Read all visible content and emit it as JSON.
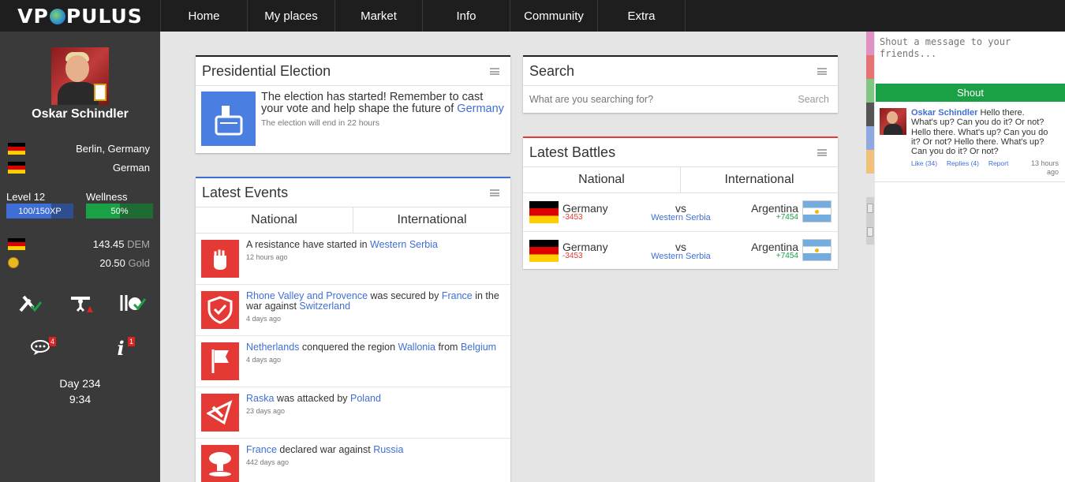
{
  "logo": {
    "left": "VP",
    "right": "PULUS"
  },
  "nav": [
    {
      "label": "Home"
    },
    {
      "label": "My places"
    },
    {
      "label": "Market"
    },
    {
      "label": "Info"
    },
    {
      "label": "Community"
    },
    {
      "label": "Extra"
    }
  ],
  "profile": {
    "name": "Oskar Schindler",
    "location": "Berlin, Germany",
    "citizenship": "German",
    "level_label": "Level 12",
    "xp_text": "100/150XP",
    "xp_fraction": 0.667,
    "wellness_label": "Wellness",
    "wellness_text": "50%",
    "wellness_fraction": 0.5,
    "currency_value": "143.45",
    "currency_code": "DEM",
    "gold_value": "20.50",
    "gold_label": "Gold",
    "messages_count": "4",
    "alerts_count": "1",
    "day": "Day 234",
    "time": "9:34"
  },
  "election": {
    "title": "Presidential Election",
    "text": "The election has started! Remember to cast your vote and help shape the future of",
    "country": "Germany",
    "subtext": "The election will end in 22 hours"
  },
  "events": {
    "title": "Latest Events",
    "tabs": [
      "National",
      "International"
    ],
    "items": [
      {
        "icon": "fist-icon",
        "parts": [
          {
            "t": "A resistance have started in ",
            "l": false
          },
          {
            "t": "Western Serbia",
            "l": true
          }
        ],
        "time": "12 hours ago"
      },
      {
        "icon": "shield-icon",
        "parts": [
          {
            "t": "Rhone Valley and Provence",
            "l": true
          },
          {
            "t": " was secured by ",
            "l": false
          },
          {
            "t": "France",
            "l": true
          },
          {
            "t": " in the war against ",
            "l": false
          },
          {
            "t": "Switzerland",
            "l": true
          }
        ],
        "time": "4 days ago"
      },
      {
        "icon": "flag-icon",
        "parts": [
          {
            "t": "Netherlands",
            "l": true
          },
          {
            "t": " conquered the region ",
            "l": false
          },
          {
            "t": "Wallonia",
            "l": true
          },
          {
            "t": " from ",
            "l": false
          },
          {
            "t": "Belgium",
            "l": true
          }
        ],
        "time": "4 days ago"
      },
      {
        "icon": "attack-icon",
        "parts": [
          {
            "t": "Raska",
            "l": true
          },
          {
            "t": " was attacked by ",
            "l": false
          },
          {
            "t": "Poland",
            "l": true
          }
        ],
        "time": "23 days ago"
      },
      {
        "icon": "explosion-icon",
        "parts": [
          {
            "t": "France",
            "l": true
          },
          {
            "t": " declared war against ",
            "l": false
          },
          {
            "t": "Russia",
            "l": true
          }
        ],
        "time": "442 days ago"
      }
    ]
  },
  "search": {
    "title": "Search",
    "placeholder": "What are you searching for?",
    "button": "Search"
  },
  "battles": {
    "title": "Latest Battles",
    "tabs": [
      "National",
      "International"
    ],
    "items": [
      {
        "left": "Germany",
        "left_score": "-3453",
        "vs": "vs",
        "region": "Western Serbia",
        "right": "Argentina",
        "right_score": "+7454"
      },
      {
        "left": "Germany",
        "left_score": "-3453",
        "vs": "vs",
        "region": "Western Serbia",
        "right": "Argentina",
        "right_score": "+7454"
      }
    ]
  },
  "chat": {
    "placeholder": "Shout a message to your friends...",
    "button": "Shout",
    "post": {
      "author": "Oskar Schindler",
      "text": "Hello there. What's up? Can you do it? Or not? Hello there. What's up? Can you do it? Or not? Hello there. What's up? Can you do it? Or not?",
      "like": "Like (34)",
      "replies": "Replies (4)",
      "report": "Report",
      "time": "13 hours ago"
    }
  },
  "colors": {
    "link": "#3f6fd6",
    "shout": "#1aa045",
    "event_icon": "#e53935",
    "election_icon": "#4a7ee0",
    "xp_bar": "#3f6fd6",
    "wellness_bar": "#1aa045"
  }
}
